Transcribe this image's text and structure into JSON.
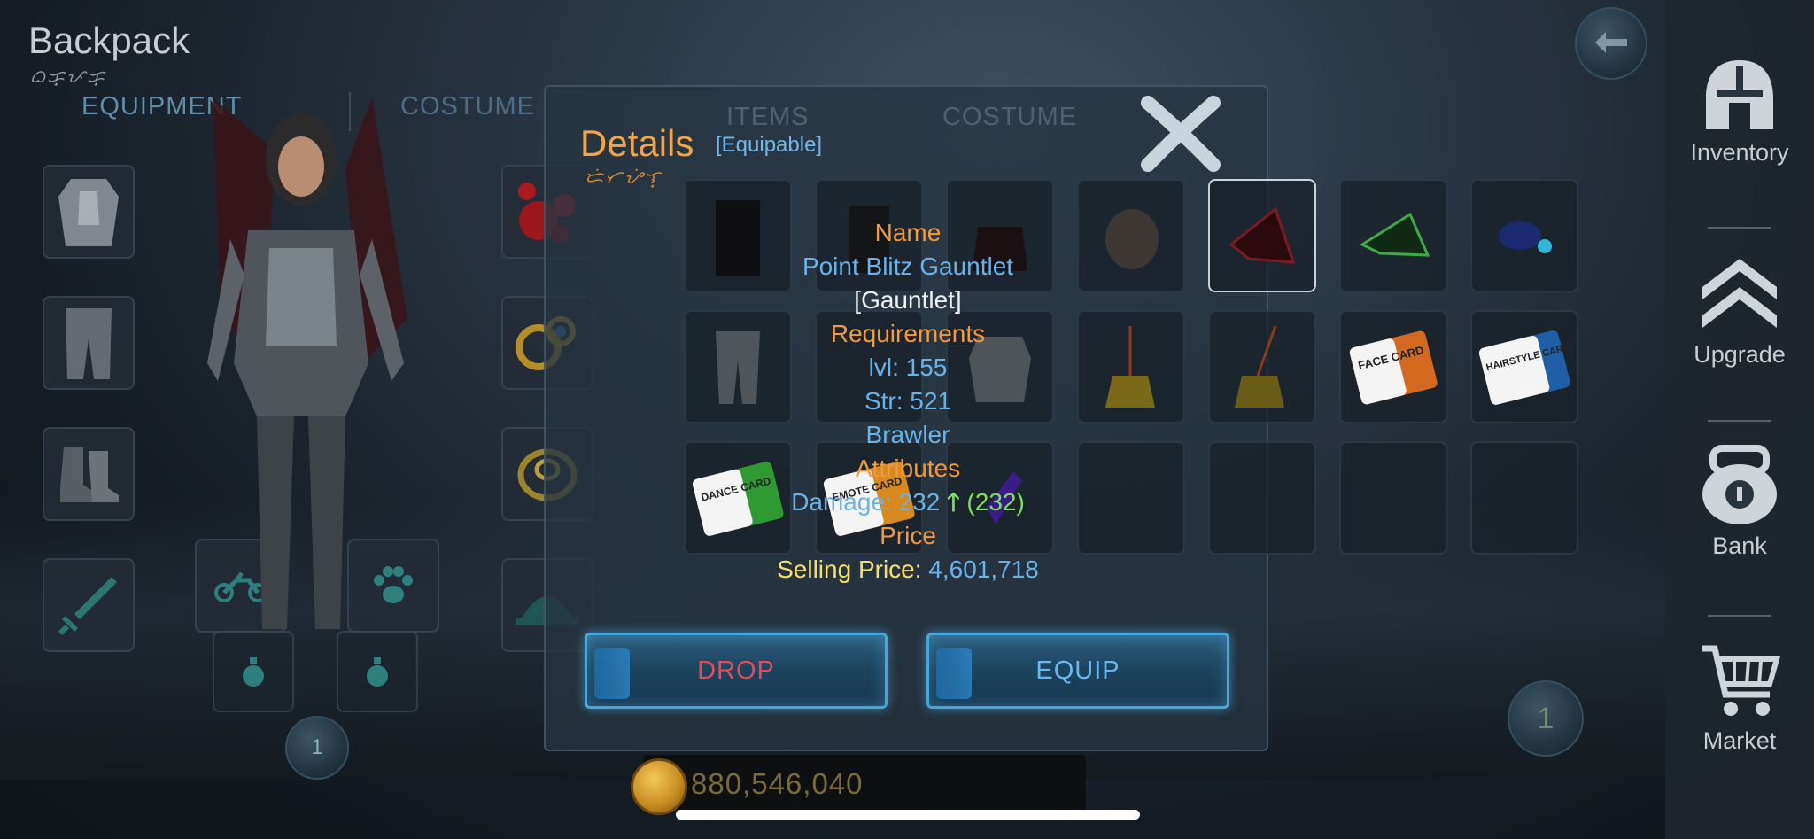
{
  "header": {
    "title": "Backpack",
    "subtitle_script": "ᜊᜃ᜔ᜉᜃ᜔",
    "tabs": [
      {
        "label": "EQUIPMENT",
        "active": true
      },
      {
        "label": "COSTUME",
        "active": false
      }
    ]
  },
  "equipment_slots": {
    "left_column": [
      "chest-armor",
      "leg-armor",
      "boots",
      "sword"
    ],
    "right_column": [
      "red-orbs",
      "ring-gold",
      "ring-gold-2",
      "hat"
    ],
    "mount_slots": [
      "motorcycle",
      "paw"
    ],
    "potion_slots": [
      "potion",
      "potion"
    ],
    "page_number": "1"
  },
  "details": {
    "title": "Details",
    "tag": "[Equipable]",
    "script": "ᜇᜒᜆᜌᜒᜎ᜔",
    "name_header": "Name",
    "item_name": "Point Blitz Gauntlet",
    "item_type": "[Gauntlet]",
    "requirements_header": "Requirements",
    "level": "lvl: 155",
    "strength": "Str: 521",
    "class": "Brawler",
    "attributes_header": "Attributes",
    "damage_label": "Damage: 232",
    "damage_arrow": "🡑",
    "damage_delta": "(232)",
    "price_header": "Price",
    "selling_label": "Selling Price: ",
    "selling_value": "4,601,718"
  },
  "inventory": {
    "tabs": [
      "ITEMS",
      "COSTUME"
    ],
    "cards": {
      "face": "FACE CARD",
      "hairstyle": "HAIRSTYLE CARD",
      "dance": "DANCE CARD",
      "emote": "EMOTE CARD"
    },
    "page_number": "1"
  },
  "actions": {
    "drop": "DROP",
    "equip": "EQUIP"
  },
  "currency": {
    "gold": "880,546,040"
  },
  "sidebar": {
    "items": [
      {
        "label": "Inventory",
        "icon": "helmet-icon"
      },
      {
        "label": "Upgrade",
        "icon": "upgrade-chevrons-icon"
      },
      {
        "label": "Bank",
        "icon": "safe-icon"
      },
      {
        "label": "Market",
        "icon": "cart-icon"
      }
    ]
  },
  "colors": {
    "accent_orange": "#f09a40",
    "accent_blue": "#67b3ea",
    "drop_red": "#e8495a",
    "price_yellow": "#f5e06a",
    "arrow_green": "#7ee05a"
  }
}
